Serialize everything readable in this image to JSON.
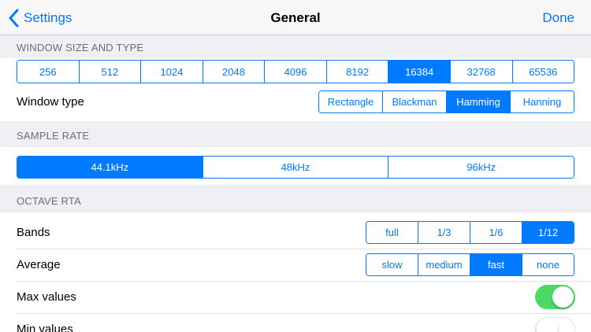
{
  "nav": {
    "back_label": "Settings",
    "title": "General",
    "done_label": "Done"
  },
  "sections": {
    "window": {
      "header": "WINDOW SIZE AND TYPE",
      "sizes": [
        "256",
        "512",
        "1024",
        "2048",
        "4096",
        "8192",
        "16384",
        "32768",
        "65536"
      ],
      "selected_size": "16384",
      "type_label": "Window type",
      "types": [
        "Rectangle",
        "Blackman",
        "Hamming",
        "Hanning"
      ],
      "selected_type": "Hamming"
    },
    "sample_rate": {
      "header": "SAMPLE RATE",
      "rates": [
        "44.1kHz",
        "48kHz",
        "96kHz"
      ],
      "selected_rate": "44.1kHz"
    },
    "octave": {
      "header": "OCTAVE RTA",
      "bands_label": "Bands",
      "bands": [
        "full",
        "1/3",
        "1/6",
        "1/12"
      ],
      "selected_band": "1/12",
      "average_label": "Average",
      "averages": [
        "slow",
        "medium",
        "fast",
        "none"
      ],
      "selected_average": "fast",
      "max_label": "Max values",
      "max_on": true,
      "min_label": "Min values",
      "min_on": false
    }
  },
  "colors": {
    "accent": "#007aff",
    "toggle_on": "#4cd964",
    "background": "#efeff4"
  }
}
